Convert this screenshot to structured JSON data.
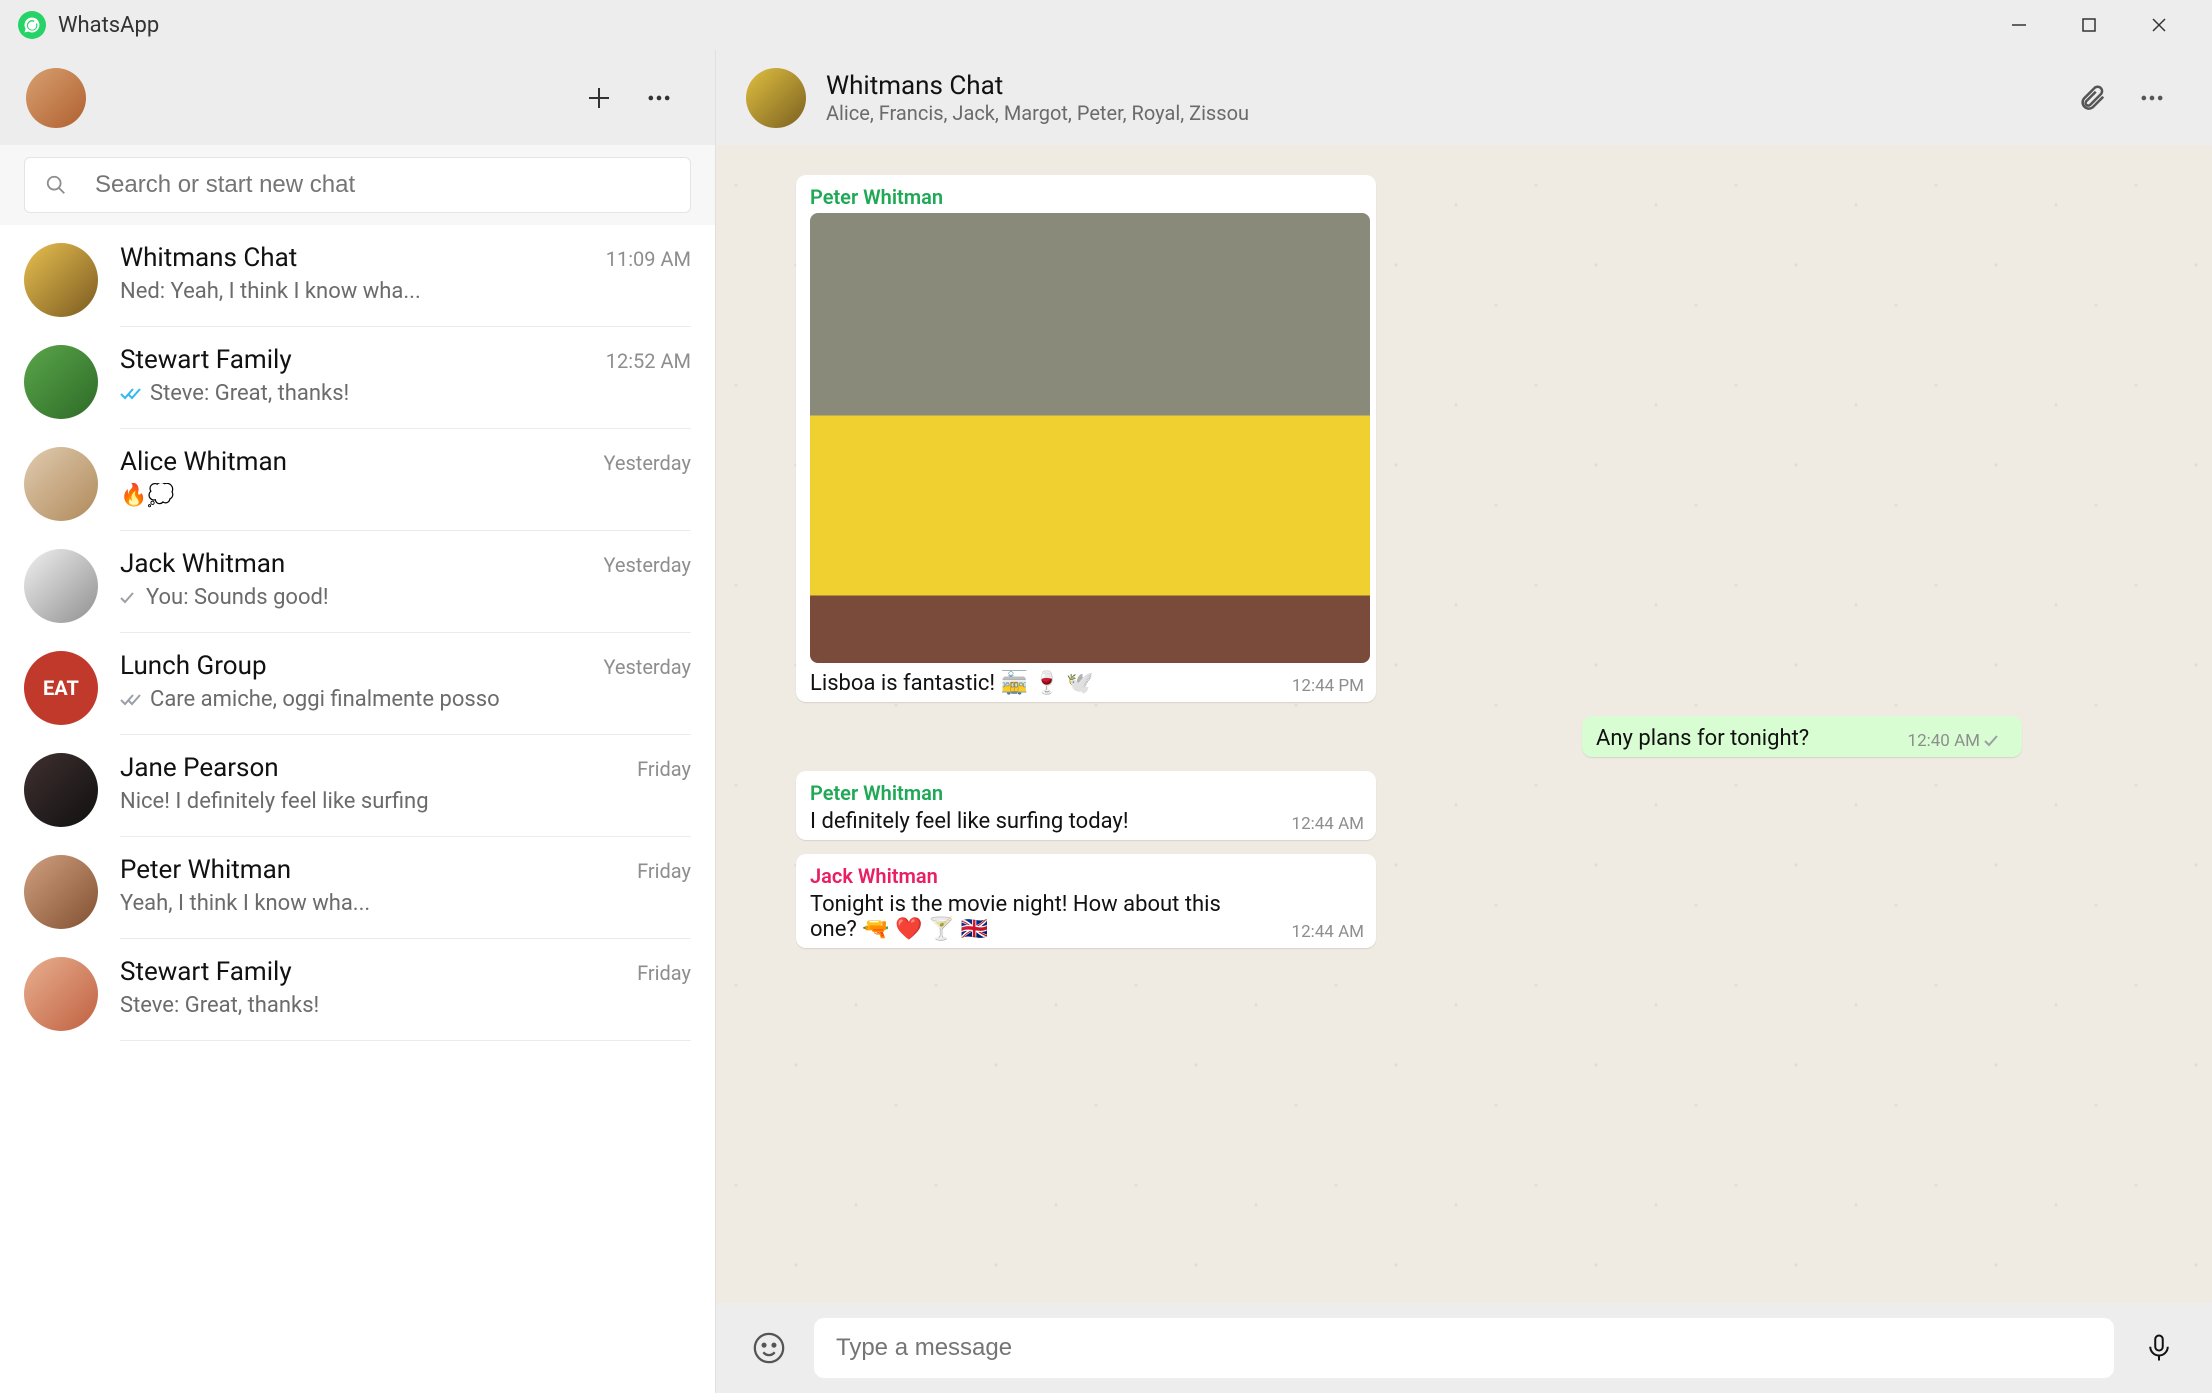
{
  "app": {
    "name": "WhatsApp"
  },
  "search": {
    "placeholder": "Search or start new chat"
  },
  "chats": [
    {
      "name": "Whitmans Chat",
      "time": "11:09 AM",
      "preview": "Ned: Yeah, I think I know wha...",
      "check": "none",
      "avatar": "av-a"
    },
    {
      "name": "Stewart Family",
      "time": "12:52 AM",
      "preview": "Steve: Great, thanks!",
      "check": "double-blue",
      "avatar": "av-b"
    },
    {
      "name": "Alice Whitman",
      "time": "Yesterday",
      "preview": "🔥💭",
      "check": "none",
      "avatar": "av-c"
    },
    {
      "name": "Jack Whitman",
      "time": "Yesterday",
      "preview": "You: Sounds good!",
      "check": "single",
      "avatar": "av-d"
    },
    {
      "name": "Lunch Group",
      "time": "Yesterday",
      "preview": "Care amiche, oggi finalmente posso",
      "check": "double-grey",
      "avatar": "av-e"
    },
    {
      "name": "Jane Pearson",
      "time": "Friday",
      "preview": "Nice! I definitely feel like surfing",
      "check": "none",
      "avatar": "av-f"
    },
    {
      "name": "Peter Whitman",
      "time": "Friday",
      "preview": "Yeah, I think I know wha...",
      "check": "none",
      "avatar": "av-g"
    },
    {
      "name": "Stewart Family",
      "time": "Friday",
      "preview": "Steve: Great, thanks!",
      "check": "none",
      "avatar": "av-h"
    }
  ],
  "conversation": {
    "title": "Whitmans Chat",
    "subtitle": "Alice, Francis, Jack, Margot, Peter, Royal, Zissou",
    "messages": [
      {
        "sender": "Peter Whitman",
        "senderColor": "green",
        "text": "Lisboa is fantastic!  🚋 🍷 🕊️",
        "time": "12:44 PM",
        "out": false,
        "hasImage": true
      },
      {
        "sender": "",
        "senderColor": "",
        "text": "Any plans for tonight?",
        "time": "12:40 AM",
        "out": true,
        "check": "single"
      },
      {
        "sender": "Peter Whitman",
        "senderColor": "green",
        "text": "I definitely feel like surfing today!",
        "time": "12:44 AM",
        "out": false
      },
      {
        "sender": "Jack Whitman",
        "senderColor": "pink",
        "text": "Tonight is the movie night! How about this one?  🔫 ❤️ 🍸 🇬🇧",
        "time": "12:44 AM",
        "out": false
      }
    ]
  },
  "composer": {
    "placeholder": "Type a message"
  }
}
